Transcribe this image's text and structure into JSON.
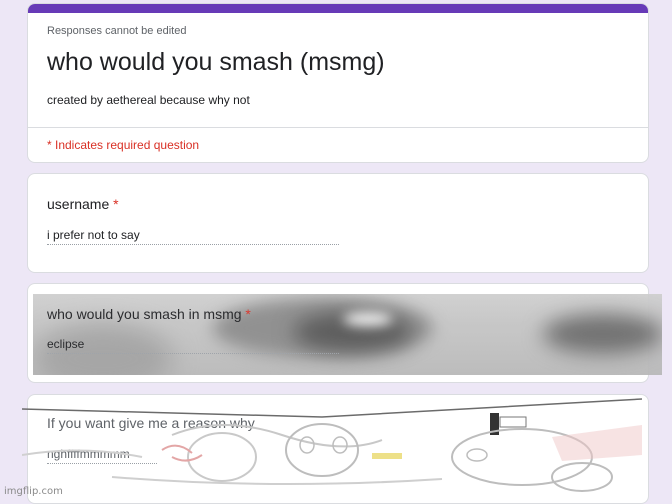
{
  "header": {
    "note": "Responses cannot be edited",
    "title": "who would you smash (msmg)",
    "description": "created by aethereal because why not",
    "required_note": "* Indicates required question"
  },
  "questions": [
    {
      "label": "username",
      "required_mark": "*",
      "answer": "i prefer not to say"
    },
    {
      "label": "who would you smash in msmg",
      "required_mark": "*",
      "answer": "eclipse"
    },
    {
      "label": "If you want give me a reason why",
      "answer": "nghffffmmmmm"
    }
  ],
  "watermark": "imgflip.com",
  "colors": {
    "accent": "#673ab7",
    "background": "#ede7f6",
    "required": "#d93025"
  }
}
